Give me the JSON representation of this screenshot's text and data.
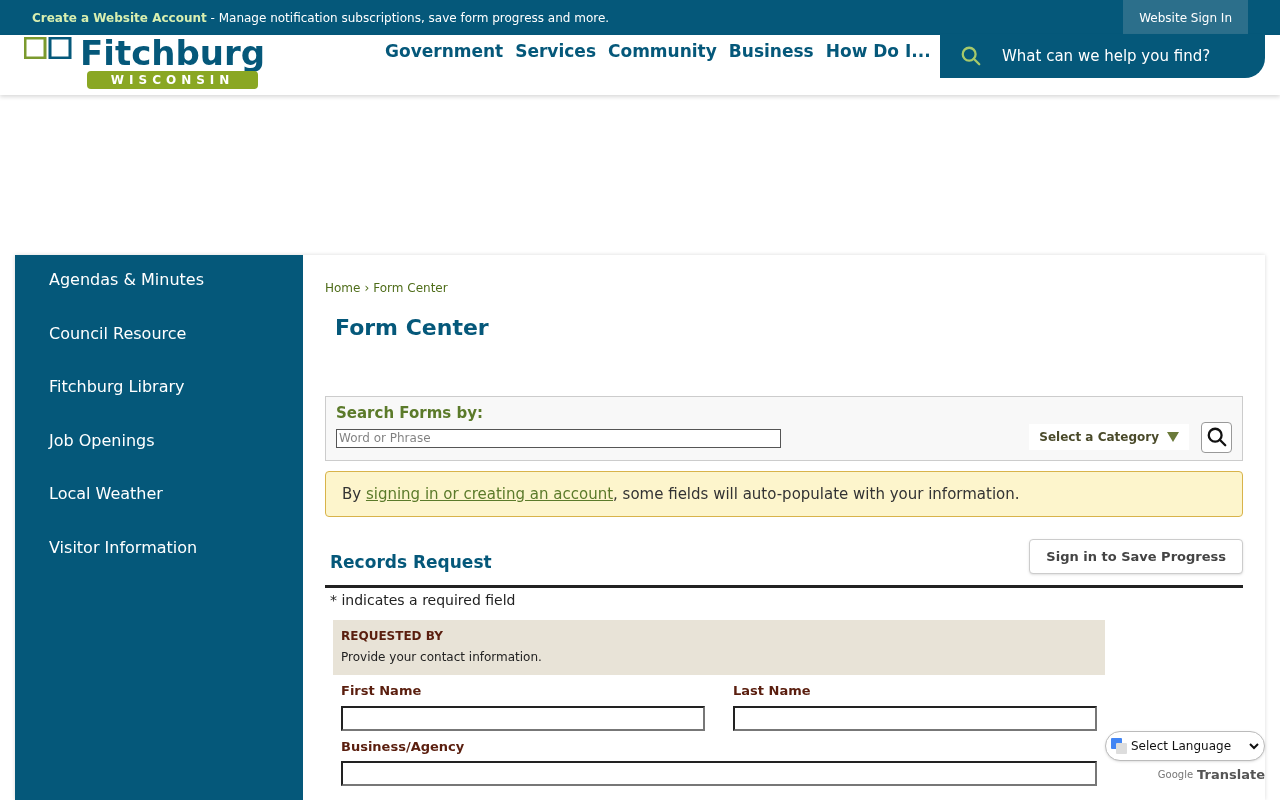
{
  "top_bar": {
    "account_link": "Create a Website Account",
    "message": " - Manage notification subscriptions, save form progress and more.",
    "sign_in": "Website Sign In"
  },
  "logo": {
    "name": "Fitchburg",
    "state": "WISCONSIN"
  },
  "nav": [
    "Government",
    "Services",
    "Community",
    "Business",
    "How Do I..."
  ],
  "site_search": {
    "placeholder": "What can we help you find?"
  },
  "sidebar": {
    "items": [
      "Agendas & Minutes",
      "Council Resource",
      "Fitchburg Library",
      "Job Openings",
      "Local Weather",
      "Visitor Information"
    ]
  },
  "breadcrumb": {
    "items": [
      "Home",
      "Form Center"
    ],
    "separator": "›"
  },
  "page_title": "Form Center",
  "form_search": {
    "label": "Search Forms by:",
    "placeholder": "Word or Phrase",
    "category": "Select a Category"
  },
  "notice": {
    "before": "By ",
    "link": "signing in or creating an account",
    "after": ", some fields will auto-populate with your information."
  },
  "form": {
    "title": "Records Request",
    "save_button": "Sign in to Save Progress",
    "required_note": "* indicates a required field",
    "section": {
      "heading": "REQUESTED BY",
      "description": "Provide your contact information."
    },
    "fields": [
      {
        "label": "First Name",
        "kind": "half"
      },
      {
        "label": "Last Name",
        "kind": "half"
      },
      {
        "label": "Business/Agency",
        "kind": "full"
      }
    ]
  },
  "translate": {
    "select": "Select Language",
    "brand": "Google",
    "label": "Translate"
  }
}
